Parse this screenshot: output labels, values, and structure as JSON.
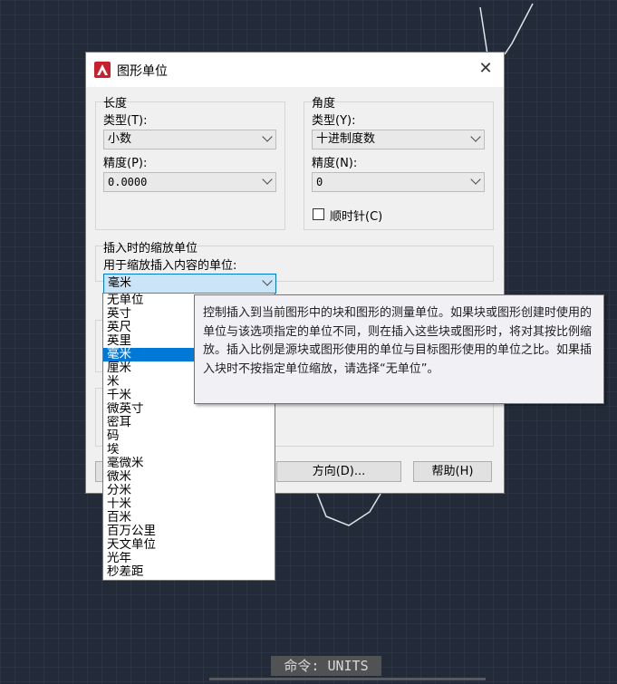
{
  "dialog": {
    "title": "图形单位",
    "close_icon": "close-icon",
    "app_icon": "autocad-logo-icon"
  },
  "length": {
    "group_label": "长度",
    "type_label": "类型(T):",
    "type_value": "小数",
    "precision_label": "精度(P):",
    "precision_value": "0.0000"
  },
  "angle": {
    "group_label": "角度",
    "type_label": "类型(Y):",
    "type_value": "十进制度数",
    "precision_label": "精度(N):",
    "precision_value": "0",
    "clockwise_label": "顺时针(C)",
    "clockwise_checked": false
  },
  "insertion_scale": {
    "group_label": "插入时的缩放单位",
    "units_label": "用于缩放插入内容的单位:",
    "selected_value": "毫米",
    "options": [
      "无单位",
      "英寸",
      "英尺",
      "英里",
      "毫米",
      "厘米",
      "米",
      "千米",
      "微英寸",
      "密耳",
      "码",
      "埃",
      "毫微米",
      "微米",
      "分米",
      "十米",
      "百米",
      "百万公里",
      "天文单位",
      "光年",
      "秒差距"
    ],
    "highlighted_index": 4
  },
  "tooltip": {
    "text": "控制插入到当前图形中的块和图形的测量单位。如果块或图形创建时使用的单位与该选项指定的单位不同，则在插入这些块或图形时，将对其按比例缩放。插入比例是源块或图形使用的单位与目标图形使用的单位之比。如果插入块时不按指定单位缩放，请选择“无单位”。"
  },
  "buttons": {
    "direction": "方向(D)...",
    "help": "帮助(H)"
  },
  "command_line": {
    "text": "命令: UNITS"
  },
  "colors": {
    "canvas_background": "#232b38",
    "selection": "#0078d7",
    "dropdown_active": "#cce4f7"
  }
}
